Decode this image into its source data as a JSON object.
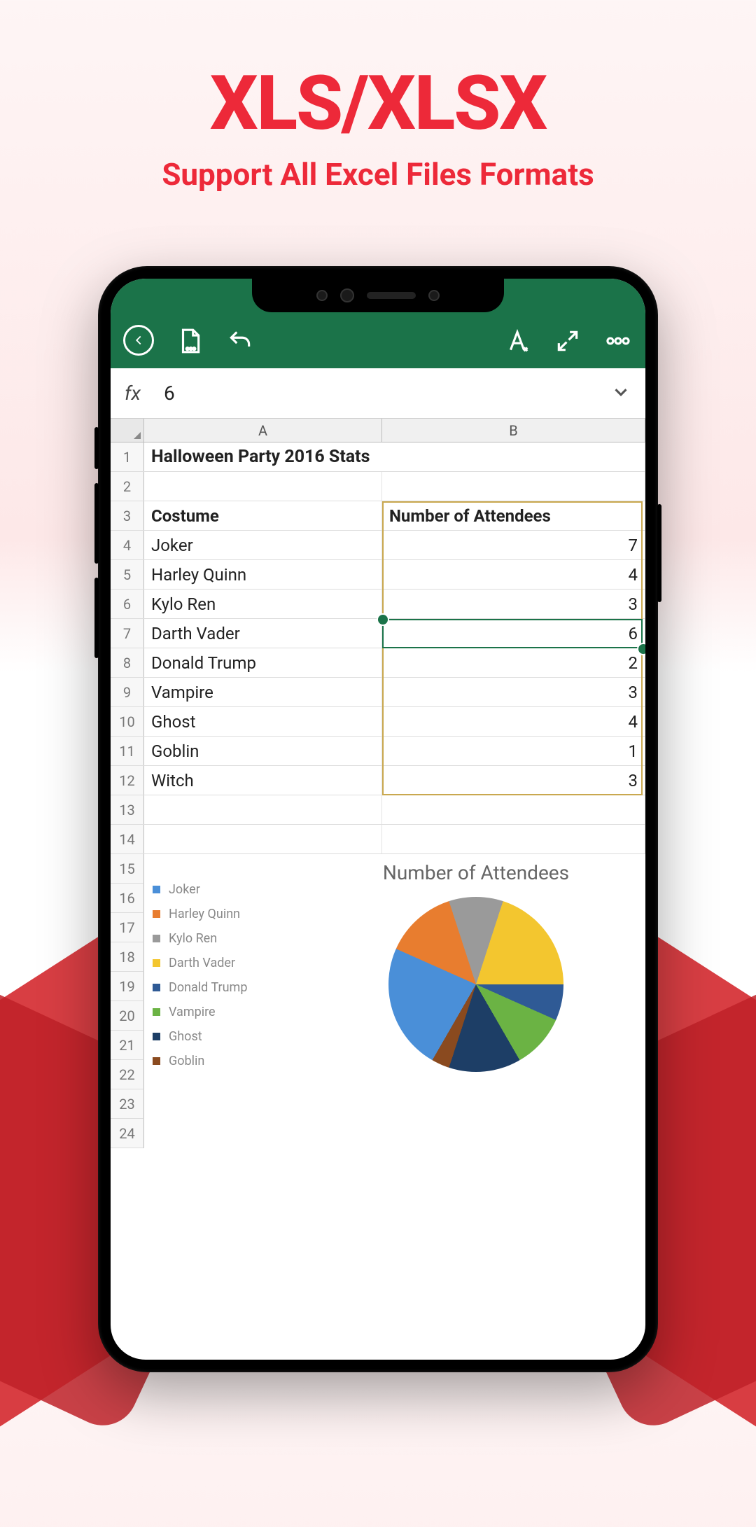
{
  "promo": {
    "title": "XLS/XLSX",
    "subtitle": "Support All Excel Files Formats"
  },
  "toolbar": {},
  "formula": {
    "label": "fx",
    "value": "6"
  },
  "columns": [
    "A",
    "B"
  ],
  "spreadsheet": {
    "title": "Halloween Party 2016 Stats",
    "headers": {
      "a": "Costume",
      "b": "Number of Attendees"
    },
    "rows": [
      {
        "n": 4,
        "a": "Joker",
        "b": 7
      },
      {
        "n": 5,
        "a": "Harley Quinn",
        "b": 4
      },
      {
        "n": 6,
        "a": "Kylo Ren",
        "b": 3
      },
      {
        "n": 7,
        "a": "Darth Vader",
        "b": 6
      },
      {
        "n": 8,
        "a": "Donald Trump",
        "b": 2
      },
      {
        "n": 9,
        "a": "Vampire",
        "b": 3
      },
      {
        "n": 10,
        "a": "Ghost",
        "b": 4
      },
      {
        "n": 11,
        "a": "Goblin",
        "b": 1
      },
      {
        "n": 12,
        "a": "Witch",
        "b": 3
      }
    ],
    "selected_cell": "B7",
    "selected_value": 6,
    "boxed_range": "B3:B12"
  },
  "side_rows": [
    13,
    14,
    15,
    16,
    17,
    18,
    19,
    20,
    21,
    22,
    23,
    24
  ],
  "chart_data": {
    "type": "pie",
    "title": "Number of Attendees",
    "series": [
      {
        "name": "Joker",
        "value": 7,
        "color": "#4a8fd8"
      },
      {
        "name": "Harley Quinn",
        "value": 4,
        "color": "#e87d2f"
      },
      {
        "name": "Kylo Ren",
        "value": 3,
        "color": "#9a9a9a"
      },
      {
        "name": "Darth Vader",
        "value": 6,
        "color": "#f3c62f"
      },
      {
        "name": "Donald Trump",
        "value": 2,
        "color": "#2f5a95"
      },
      {
        "name": "Vampire",
        "value": 3,
        "color": "#6bb344"
      },
      {
        "name": "Ghost",
        "value": 4,
        "color": "#1d3e66"
      },
      {
        "name": "Goblin",
        "value": 1,
        "color": "#8a4a1f"
      }
    ]
  }
}
